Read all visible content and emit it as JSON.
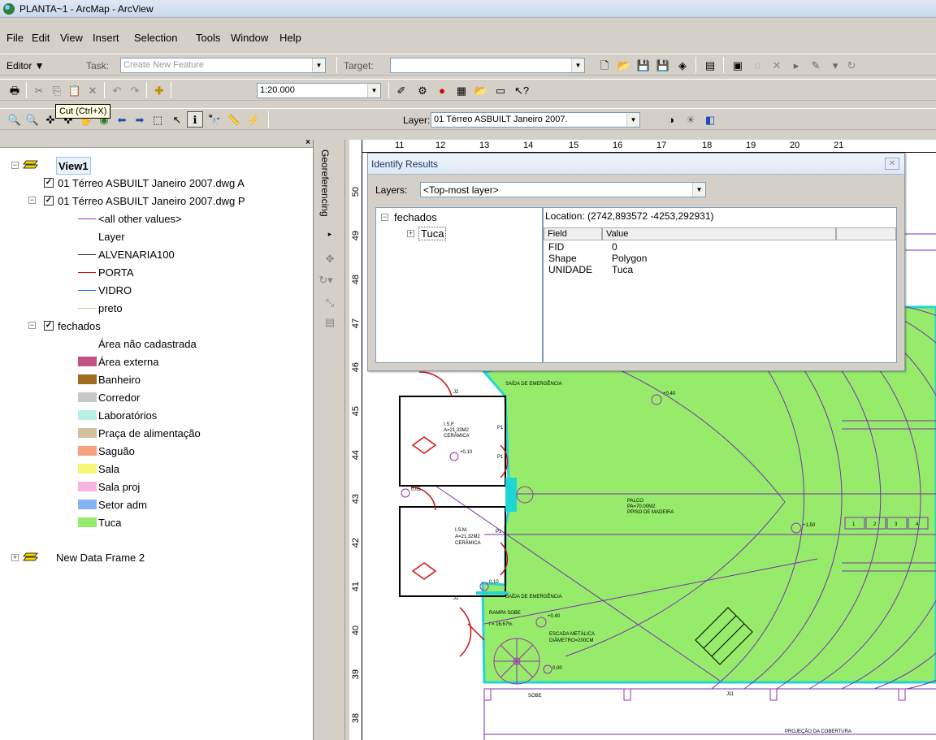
{
  "window": {
    "title": "PLANTA~1 - ArcMap - ArcView"
  },
  "menu": [
    "File",
    "Edit",
    "View",
    "Insert",
    "Selection",
    "Tools",
    "Window",
    "Help"
  ],
  "editor": {
    "label": "Editor ▼",
    "task_label": "Task:",
    "task_value": "Create New Feature",
    "target_label": "Target:",
    "target_value": ""
  },
  "standard": {
    "scale": "1:20.000"
  },
  "tooltip": "Cut (Ctrl+X)",
  "tools": {
    "layer_label": "Layer:",
    "layer_value": "01 Térreo ASBUILT Janeiro 2007."
  },
  "toc": {
    "view1": "View1",
    "layer_a": "01 Térreo ASBUILT Janeiro 2007.dwg A",
    "layer_p": "01 Térreo ASBUILT Janeiro 2007.dwg P",
    "line_legend": [
      {
        "label": "<all other values>",
        "color": "#9b2fae"
      },
      {
        "label": "Layer",
        "color": ""
      },
      {
        "label": "ALVENARIA100",
        "color": "#333333"
      },
      {
        "label": "PORTA",
        "color": "#d01010"
      },
      {
        "label": "VIDRO",
        "color": "#2060d0"
      },
      {
        "label": "preto",
        "color": "#e9b98a"
      }
    ],
    "fechados": "fechados",
    "poly_legend": [
      {
        "label": "Área  não cadastrada",
        "color": ""
      },
      {
        "label": "Área externa",
        "color": "#c45186"
      },
      {
        "label": "Banheiro",
        "color": "#a06b1d"
      },
      {
        "label": "Corredor",
        "color": "#c8c8c8"
      },
      {
        "label": "Laboratórios",
        "color": "#b8f0e6"
      },
      {
        "label": "Praça de alimentação",
        "color": "#d2bf9b"
      },
      {
        "label": "Saguão",
        "color": "#f6a27e"
      },
      {
        "label": "Sala",
        "color": "#f6f676"
      },
      {
        "label": "Sala proj",
        "color": "#f8b6de"
      },
      {
        "label": "Setor adm",
        "color": "#84b4f6"
      },
      {
        "label": "Tuca",
        "color": "#96ec6a"
      }
    ],
    "data_frame2": "New Data Frame 2"
  },
  "georef": {
    "label": "Georeferencing"
  },
  "ruler": {
    "top": [
      "11",
      "12",
      "13",
      "14",
      "15",
      "16",
      "17",
      "18",
      "19",
      "20",
      "21"
    ],
    "left": [
      "50",
      "49",
      "48",
      "47",
      "46",
      "45",
      "44",
      "43",
      "42",
      "41",
      "40",
      "39",
      "38"
    ]
  },
  "identify": {
    "title": "Identify Results",
    "layers_label": "Layers:",
    "layers_value": "<Top-most layer>",
    "tree_root": "fechados",
    "tree_child": "Tuca",
    "location": "Location: (2742,893572 -4253,292931)",
    "col_field": "Field",
    "col_value": "Value",
    "rows": [
      {
        "field": "FID",
        "value": "0"
      },
      {
        "field": "Shape",
        "value": "Polygon"
      },
      {
        "field": "UNIDADE",
        "value": "Tuca"
      }
    ]
  },
  "map_labels": {
    "saida1": "SAÍDA DE EMERGÊNCIA",
    "saida2": "SAÍDA DE EMERGÊNCIA",
    "palco1": "PALCO",
    "palco2": "PA=70,00M2",
    "palco3": "PPISO DE MADEIRA",
    "ism1a": "I.S.F.",
    "ism1b": "A=21,33M2",
    "ism1c": "CERÂMICA",
    "ism2a": "I.S.M.",
    "ism2b": "A=21,32M2",
    "ism2c": "CERÂMICA",
    "rampa1": "RAMPA SOBE",
    "rampa2": "i = 16,67%",
    "escada1": "ESCADA METÁLICA",
    "escada2": "DIÂMETRO=200CM",
    "proj": "PROJEÇÃO DA COBERTURA",
    "sobe": "SOBE",
    "j11": "J11",
    "j2a": "J2",
    "j2b": "J2",
    "lvl1": "+0,40",
    "lvl2": "+0,10",
    "lvl3": "0,05",
    "lvl4": "0,10",
    "lvl5": "+1,50",
    "lvl6": "+0,40",
    "lvl7": "0,00",
    "p1": "P1",
    "p2": "P1",
    "p3": "P1",
    "seat1": "1",
    "seat2": "2",
    "seat3": "3",
    "seat4": "4"
  }
}
